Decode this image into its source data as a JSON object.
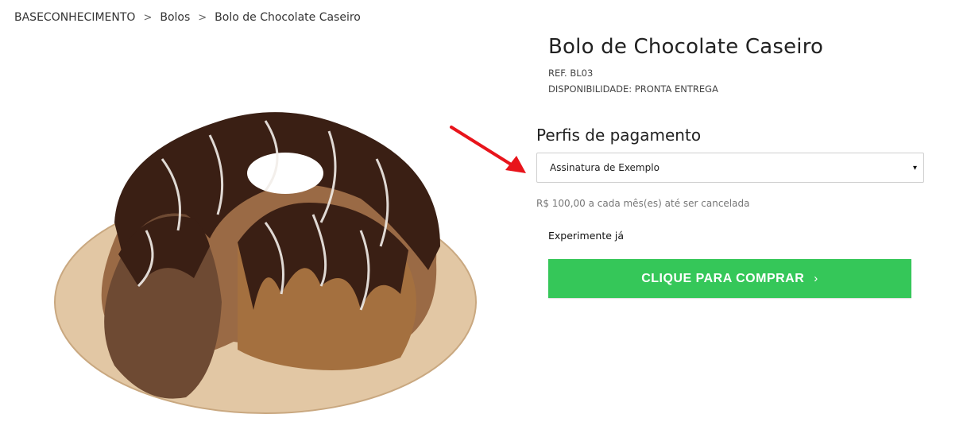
{
  "breadcrumb": {
    "items": [
      "BASECONHECIMENTO",
      "Bolos",
      "Bolo de Chocolate Caseiro"
    ],
    "separator": ">"
  },
  "product": {
    "title": "Bolo de Chocolate Caseiro",
    "ref": "REF. BL03",
    "availability": "DISPONIBILIDADE: PRONTA ENTREGA"
  },
  "payment": {
    "heading": "Perfis de pagamento",
    "selected": "Assinatura de Exemplo",
    "price_text": "R$ 100,00 a cada mês(es) até ser cancelada",
    "trial_text": "Experimente já"
  },
  "cta": {
    "label": "CLIQUE PARA COMPRAR",
    "chevron": "›"
  },
  "colors": {
    "button": "#35c759",
    "annotation_arrow": "#e8141b",
    "chocolate": "#3a1f14",
    "board": "#e2c7a4"
  },
  "icons": {
    "select_caret": "▾",
    "breadcrumb_sep": "chevron-right-icon"
  }
}
